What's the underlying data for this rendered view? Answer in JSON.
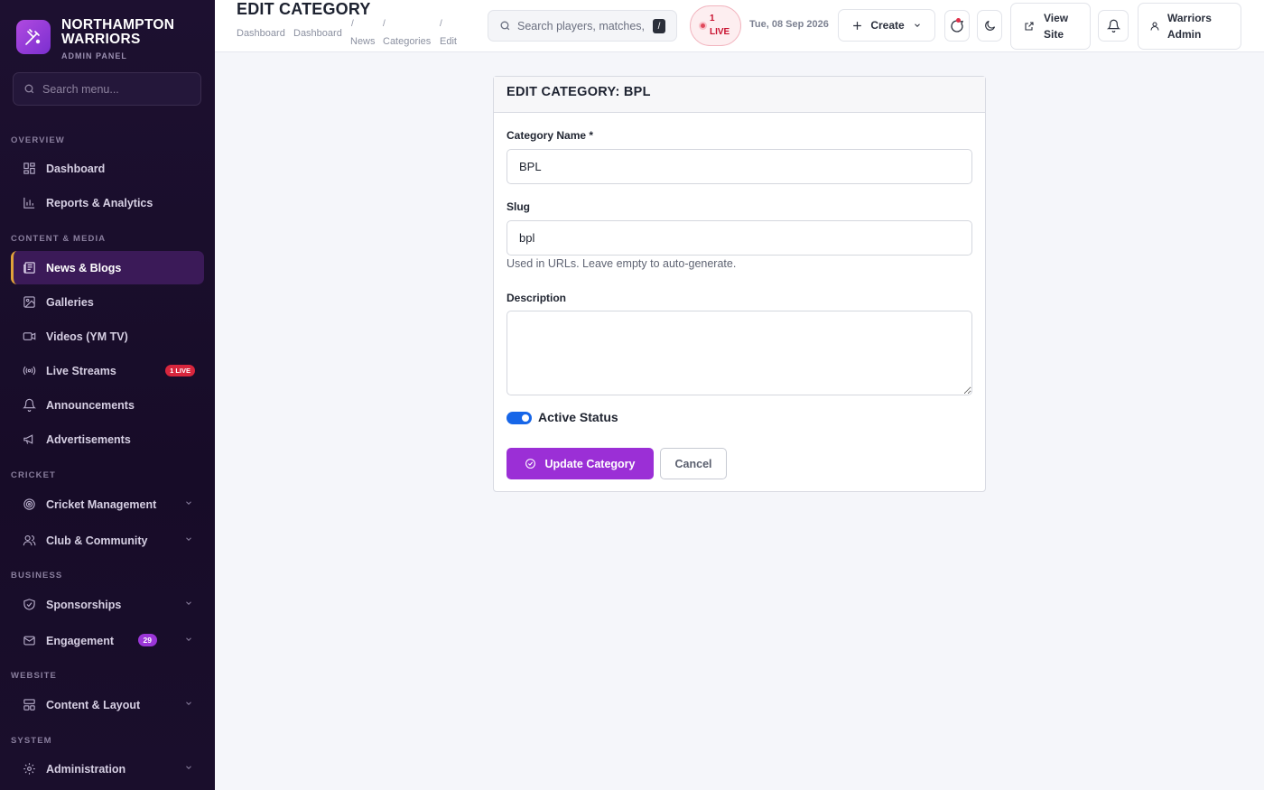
{
  "brand": {
    "name": "Northampton Warriors",
    "subtitle": "ADMIN PANEL"
  },
  "sidebar": {
    "search_placeholder": "Search menu...",
    "sections": {
      "overview": "OVERVIEW",
      "content_media": "CONTENT & MEDIA",
      "cricket": "CRICKET",
      "business": "BUSINESS",
      "website": "WEBSITE",
      "system": "SYSTEM"
    },
    "items": {
      "dashboard": "Dashboard",
      "reports": "Reports & Analytics",
      "news": "News & Blogs",
      "galleries": "Galleries",
      "videos": "Videos (YM TV)",
      "live_streams": "Live Streams",
      "live_badge": "1 LIVE",
      "announcements": "Announcements",
      "advertisements": "Advertisements",
      "cricket_management": "Cricket Management",
      "club_community": "Club & Community",
      "sponsorships": "Sponsorships",
      "engagement": "Engagement",
      "engagement_count": "29",
      "content_layout": "Content & Layout",
      "administration": "Administration"
    },
    "active_item": "news"
  },
  "header": {
    "title": "EDIT CATEGORY",
    "breadcrumb": {
      "dashboard_a": "Dashboard",
      "dashboard_b": "Dashboard",
      "news": "News",
      "categories": "Categories",
      "edit": "Edit",
      "sep": "/"
    },
    "search_placeholder": "Search players, matches, n",
    "search_shortcut": "/",
    "live": {
      "count": "1",
      "label": "LIVE"
    },
    "date": "Tue, 08 Sep 2026",
    "create_label": "Create",
    "view_site_line1": "View",
    "view_site_line2": "Site",
    "user_line1": "Warriors",
    "user_line2": "Admin"
  },
  "form": {
    "heading": "EDIT CATEGORY: BPL",
    "name_label": "Category Name *",
    "name_value": "BPL",
    "slug_label": "Slug",
    "slug_value": "bpl",
    "slug_hint": "Used in URLs. Leave empty to auto-generate.",
    "description_label": "Description",
    "description_value": "",
    "active_label": "Active Status",
    "active": true,
    "submit_label": "Update Category",
    "cancel_label": "Cancel"
  },
  "colors": {
    "accent": "#9b2fd6",
    "sidebar_bg": "#1d1030",
    "live_red": "#c8102e",
    "toggle_blue": "#1766e8"
  }
}
